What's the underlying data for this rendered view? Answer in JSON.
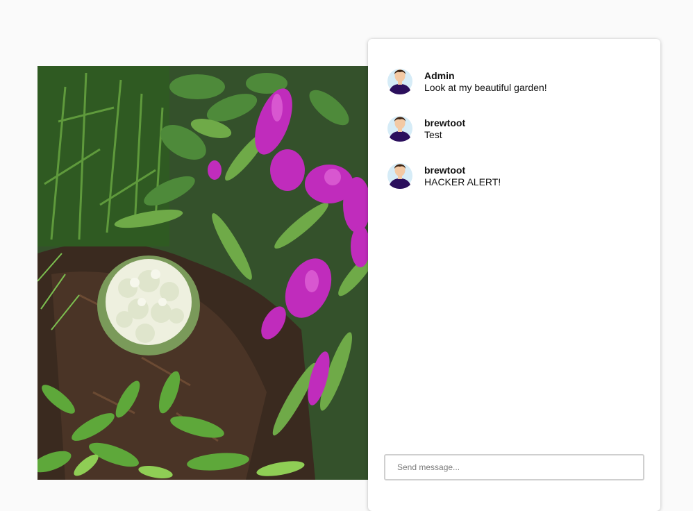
{
  "post": {
    "image_alt": "Garden photo with cauliflower and purple salvia flowers"
  },
  "comments": [
    {
      "username": "Admin",
      "message": "Look at my beautiful garden!",
      "avatar_icon": "user-avatar-icon"
    },
    {
      "username": "brewtoot",
      "message": "Test",
      "avatar_icon": "user-avatar-icon"
    },
    {
      "username": "brewtoot",
      "message": "HACKER ALERT!",
      "avatar_icon": "user-avatar-icon"
    }
  ],
  "composer": {
    "placeholder": "Send message...",
    "value": ""
  },
  "colors": {
    "page_bg": "#fafafa",
    "card_bg": "#ffffff",
    "avatar_bg": "#d6ecf7",
    "avatar_shirt": "#2b0f5c",
    "avatar_hair": "#3a2416",
    "avatar_skin": "#f3c9a4"
  }
}
